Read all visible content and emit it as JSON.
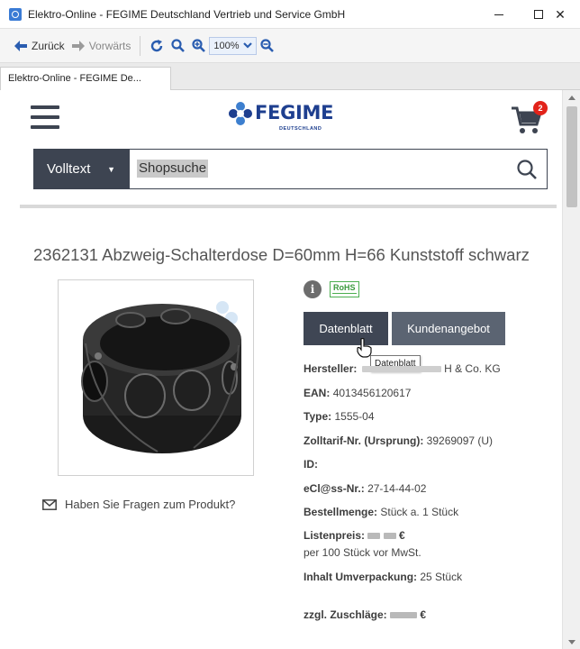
{
  "window": {
    "title": "Elektro-Online - FEGIME Deutschland Vertrieb und Service GmbH",
    "minimize": "—",
    "close": "✕"
  },
  "toolbar": {
    "back_label": "Zurück",
    "forward_label": "Vorwärts",
    "zoom_value": "100%"
  },
  "tab": {
    "label": "Elektro-Online - FEGIME De..."
  },
  "site": {
    "logo_text": "FEGIME",
    "logo_subtext": "DEUTSCHLAND",
    "cart_count": "2",
    "search": {
      "scope": "Volltext",
      "placeholder": "Shopsuche"
    }
  },
  "product": {
    "title": "2362131 Abzweig-Schalterdose D=60mm H=66 Kunststoff schwarz",
    "question_link": "Haben Sie Fragen zum Produkt?",
    "rohs_label": "RoHS",
    "buttons": {
      "datenblatt": "Datenblatt",
      "kundenangebot": "Kundenangebot"
    },
    "tooltip": "Datenblatt",
    "attributes": {
      "hersteller_key": "Hersteller:",
      "hersteller_value_visible": "H & Co. KG",
      "ean_key": "EAN:",
      "ean_value": "4013456120617",
      "type_key": "Type:",
      "type_value": "1555-04",
      "zolltarif_key": "Zolltarif-Nr. (Ursprung):",
      "zolltarif_value": "39269097 (U)",
      "id_key": "ID:",
      "eclass_key": "eCl@ss-Nr.:",
      "eclass_value": "27-14-44-02",
      "bestellmenge_key": "Bestellmenge:",
      "bestellmenge_value": "Stück a. 1 Stück",
      "listenpreis_key": "Listenpreis:",
      "listenpreis_currency": "€",
      "listenpreis_note": "per 100 Stück vor MwSt.",
      "inhalt_key": "Inhalt Umverpackung:",
      "inhalt_value": "25 Stück",
      "zuschlaege_key": "zzgl. Zuschläge:",
      "zuschlaege_currency": "€"
    }
  },
  "colors": {
    "brand_blue": "#1e3f8f",
    "dark_button": "#3f4654",
    "badge_red": "#e2231a",
    "rohs_green": "#4caf50"
  }
}
